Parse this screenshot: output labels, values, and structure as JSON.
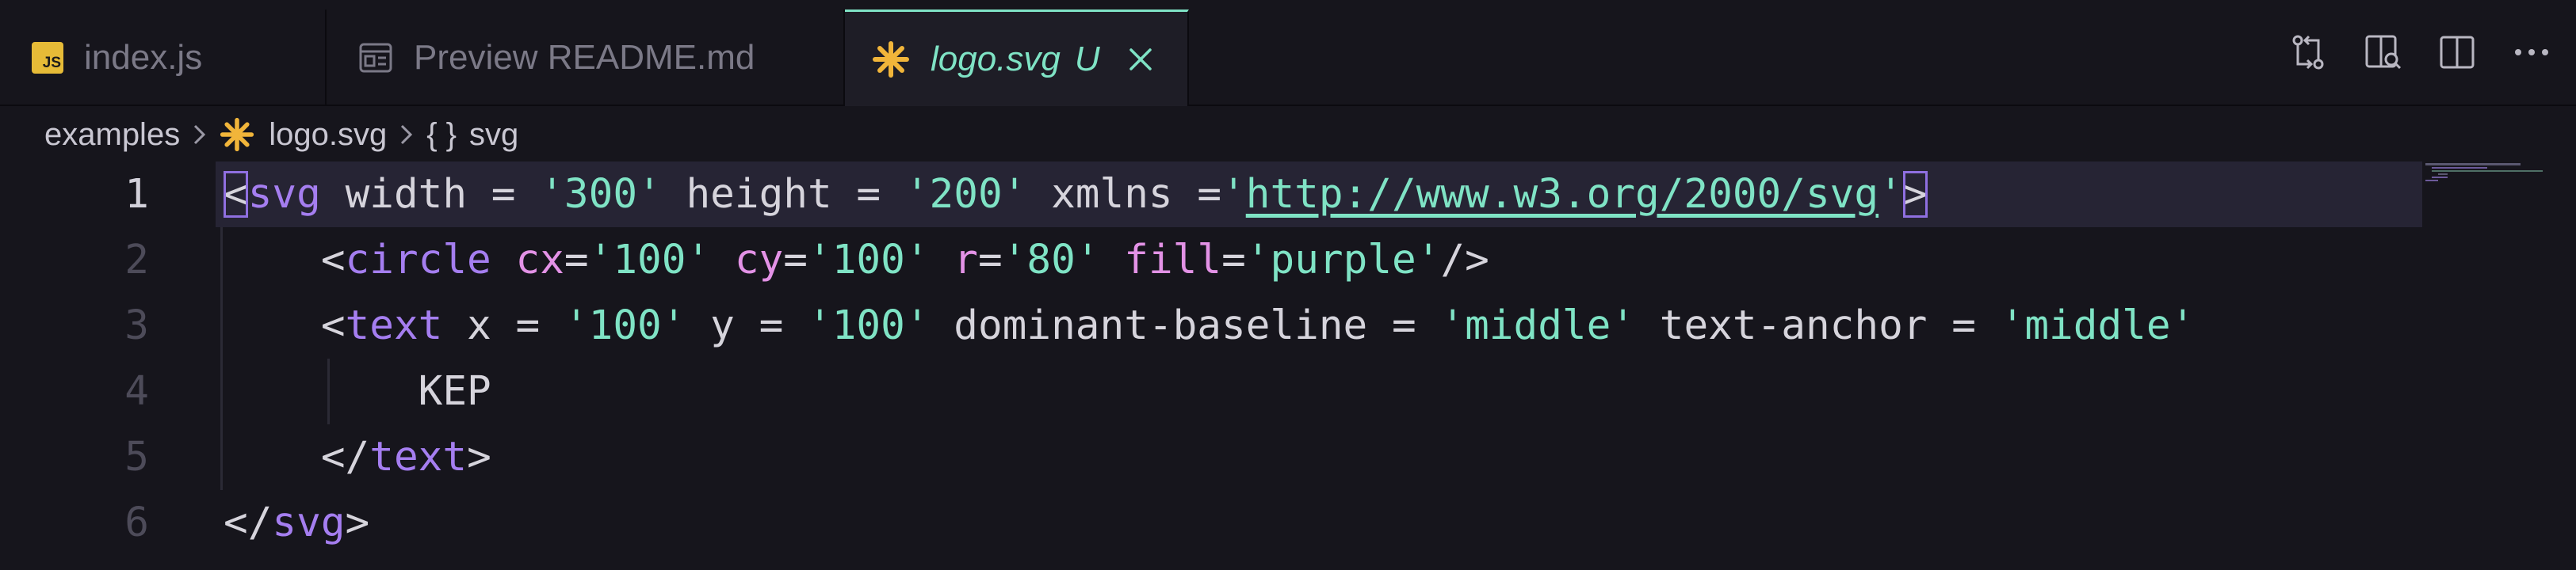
{
  "tabs": [
    {
      "label": "index.js",
      "icon": "javascript-file-icon",
      "active": false
    },
    {
      "label": "Preview README.md",
      "icon": "preview-icon",
      "active": false
    },
    {
      "label": "logo.svg",
      "icon": "svg-file-icon",
      "active": true,
      "badge": "U"
    }
  ],
  "actions": [
    "source-control-compare-icon",
    "open-preview-icon",
    "split-editor-icon",
    "more-actions-icon"
  ],
  "breadcrumb": {
    "folder": "examples",
    "file": "logo.svg",
    "symbol_glyph": "{ }",
    "symbol": "svg"
  },
  "editor": {
    "lines": [
      {
        "number": "1"
      },
      {
        "number": "2"
      },
      {
        "number": "3"
      },
      {
        "number": "4"
      },
      {
        "number": "5"
      },
      {
        "number": "6"
      }
    ],
    "line1": {
      "tag": "svg",
      "w_attr": "width",
      "w_val": "'300'",
      "h_attr": "height",
      "h_val": "'200'",
      "x_attr": "xmlns",
      "x_q1": "'",
      "x_url": "http://www.w3.org/2000/svg",
      "x_q2": "'"
    },
    "line2": {
      "tag": "circle",
      "cx_attr": "cx",
      "cx_val": "'100'",
      "cy_attr": "cy",
      "cy_val": "'100'",
      "r_attr": "r",
      "r_val": "'80'",
      "f_attr": "fill",
      "f_val": "'purple'"
    },
    "line3": {
      "tag": "text",
      "x_attr": "x",
      "x_val": "'100'",
      "y_attr": "y",
      "y_val": "'100'",
      "db_attr": "dominant-baseline",
      "db_val": "'middle'",
      "ta_attr": "text-anchor",
      "ta_val": "'middle'"
    },
    "line4": {
      "text": "KEP"
    },
    "line5": {
      "tag": "text"
    },
    "line6": {
      "tag": "svg"
    }
  },
  "colors": {
    "accent": "#7fe3c5",
    "tag": "#a57ef0",
    "attribute": "#e392e6",
    "string": "#7fe3c5",
    "background": "#16151c"
  }
}
